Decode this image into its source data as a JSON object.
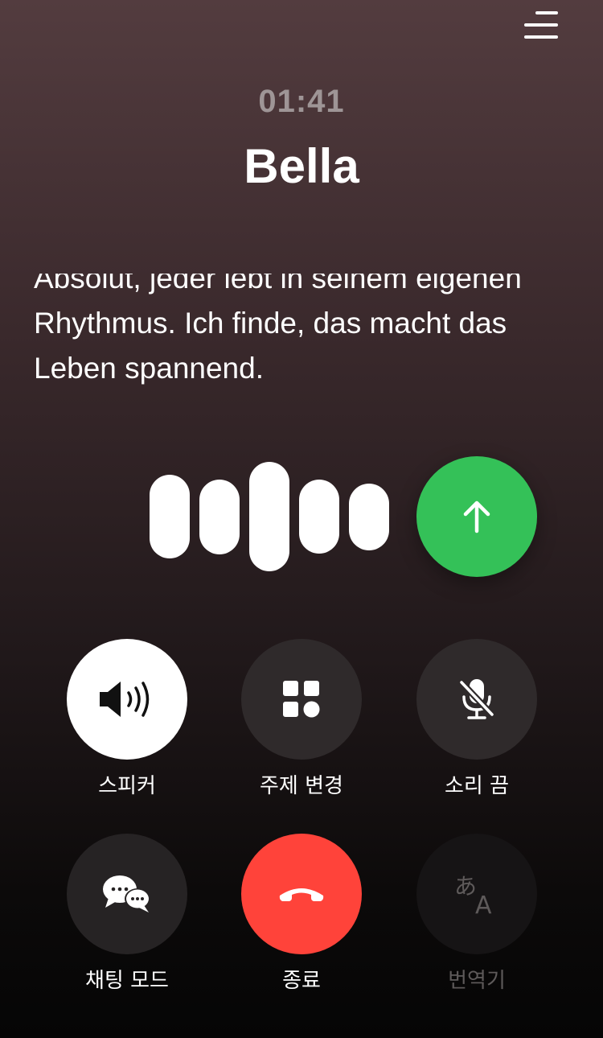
{
  "header": {
    "menu_icon": "hamburger-menu-icon",
    "timer": "01:41",
    "contact_name": "Bella"
  },
  "transcript": {
    "text": "Absolut, jeder lebt in seinem eigenen Rhythmus. Ich finde, das macht das Leben spannend."
  },
  "voice": {
    "send_icon": "arrow-up-icon",
    "send_color": "#34c158"
  },
  "controls": [
    {
      "label": "스피커",
      "icon": "speaker-icon",
      "state": "active"
    },
    {
      "label": "주제 변경",
      "icon": "grid-shapes-icon",
      "state": "normal"
    },
    {
      "label": "소리 끔",
      "icon": "mic-muted-icon",
      "state": "normal"
    },
    {
      "label": "채팅 모드",
      "icon": "chat-bubbles-icon",
      "state": "normal"
    },
    {
      "label": "종료",
      "icon": "phone-hangup-icon",
      "state": "danger"
    },
    {
      "label": "번역기",
      "icon": "translate-icon",
      "state": "disabled"
    }
  ],
  "colors": {
    "end_call": "#ff433a",
    "active_control": "#ffffff"
  }
}
